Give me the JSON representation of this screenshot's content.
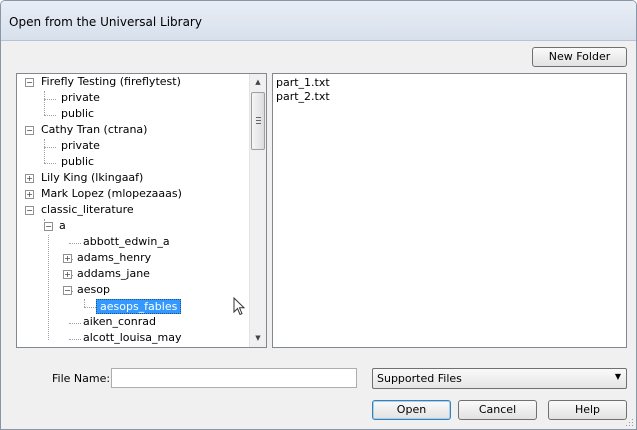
{
  "window": {
    "title": "Open from the Universal Library"
  },
  "toolbar": {
    "new_folder_label": "New Folder"
  },
  "tree": {
    "nodes": [
      {
        "label": "Firefly Testing (fireflytest)",
        "state": "expanded"
      },
      {
        "label": "private"
      },
      {
        "label": "public"
      },
      {
        "label": "Cathy Tran (ctrana)",
        "state": "expanded"
      },
      {
        "label": "private"
      },
      {
        "label": "public"
      },
      {
        "label": "Lily King (lkingaaf)",
        "state": "collapsed"
      },
      {
        "label": "Mark Lopez (mlopezaaas)",
        "state": "collapsed"
      },
      {
        "label": "classic_literature",
        "state": "expanded"
      },
      {
        "label": "a",
        "state": "expanded"
      },
      {
        "label": "abbott_edwin_a"
      },
      {
        "label": "adams_henry",
        "state": "collapsed"
      },
      {
        "label": "addams_jane",
        "state": "collapsed"
      },
      {
        "label": "aesop",
        "state": "expanded"
      },
      {
        "label": "aesops_fables",
        "selected": true
      },
      {
        "label": "aiken_conrad"
      },
      {
        "label": "alcott_louisa_may"
      }
    ]
  },
  "files": {
    "items": [
      "part_1.txt",
      "part_2.txt"
    ]
  },
  "form": {
    "file_name_label": "File Name:",
    "file_name_value": "",
    "file_type_selected": "Supported Files"
  },
  "buttons": {
    "open_label": "Open",
    "cancel_label": "Cancel",
    "help_label": "Help"
  },
  "colors": {
    "selection": "#3399ff",
    "titlebar": "#dfe6f0",
    "dialog_bg": "#f0f0f0"
  },
  "icons": [
    "scroll-up-icon",
    "scroll-down-icon",
    "dropdown-chevron-icon",
    "mouse-pointer-icon",
    "resize-grip-icon"
  ]
}
